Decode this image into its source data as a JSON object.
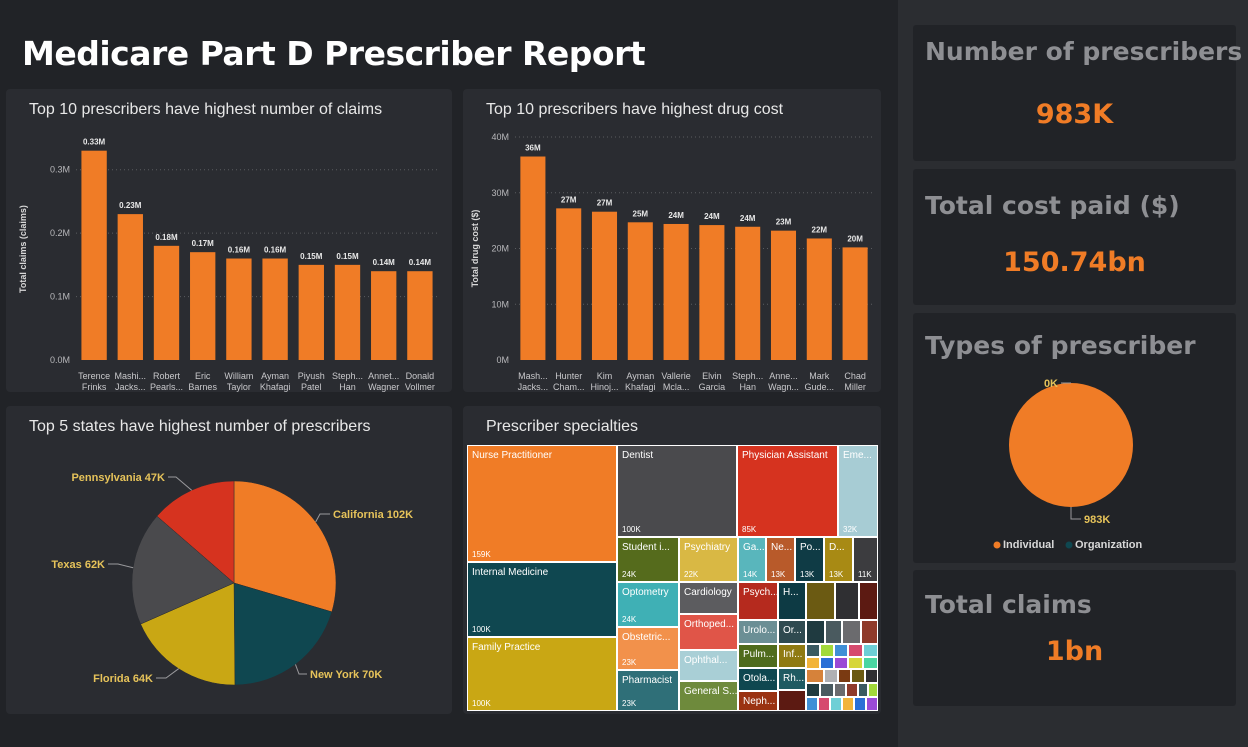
{
  "report": {
    "title": "Medicare Part D Prescriber Report"
  },
  "colors": {
    "accent": "#f07c26",
    "background": "#212327",
    "panel": "#2a2c31",
    "card_title": "#8e8f93"
  },
  "kpis": {
    "prescribers": {
      "title": "Number of prescribers",
      "value": "983K"
    },
    "cost": {
      "title": "Total cost paid ($)",
      "value": "150.74bn"
    },
    "types": {
      "title": "Types of prescriber"
    },
    "claims": {
      "title": "Total claims",
      "value": "1bn"
    }
  },
  "chart_data": [
    {
      "type": "bar",
      "title": "Top 10 prescribers have highest number of claims",
      "ylabel": "Total claims (claims)",
      "xlabel": "",
      "categories": [
        "Terence Frinks",
        "Mashi... Jacks...",
        "Robert Pearls...",
        "Eric Barnes",
        "William Taylor",
        "Ayman Khafagi",
        "Piyush Patel",
        "Steph... Han",
        "Annet... Wagner",
        "Donald Vollmer"
      ],
      "values": [
        0.33,
        0.23,
        0.18,
        0.17,
        0.16,
        0.16,
        0.15,
        0.15,
        0.14,
        0.14
      ],
      "data_labels": [
        "0.33M",
        "0.23M",
        "0.18M",
        "0.17M",
        "0.16M",
        "0.16M",
        "0.15M",
        "0.15M",
        "0.14M",
        "0.14M"
      ],
      "yticks": [
        0,
        0.1,
        0.2,
        0.3
      ],
      "ytick_labels": [
        "0.0M",
        "0.1M",
        "0.2M",
        "0.3M"
      ],
      "ylim": [
        0,
        0.35
      ],
      "color": "#f07c26",
      "grid": true
    },
    {
      "type": "bar",
      "title": "Top 10 prescribers have highest drug cost",
      "ylabel": "Total drug cost ($)",
      "xlabel": "",
      "categories": [
        "Mash... Jacks...",
        "Hunter Cham...",
        "Kim Hinoj...",
        "Ayman Khafagi",
        "Vallerie Mcla...",
        "Elvin Garcia",
        "Steph... Han",
        "Anne... Wagn...",
        "Mark Gude...",
        "Chad Miller"
      ],
      "values": [
        36.5,
        27.2,
        26.6,
        24.7,
        24.4,
        24.2,
        23.9,
        23.2,
        21.8,
        20.2
      ],
      "data_labels": [
        "36M",
        "27M",
        "27M",
        "25M",
        "24M",
        "24M",
        "24M",
        "23M",
        "22M",
        "20M"
      ],
      "yticks": [
        0,
        10,
        20,
        30,
        40
      ],
      "ytick_labels": [
        "0M",
        "10M",
        "20M",
        "30M",
        "40M"
      ],
      "ylim": [
        0,
        40
      ],
      "color": "#f07c26",
      "grid": true
    },
    {
      "type": "pie",
      "title": "Top 5 states have highest number of prescribers",
      "slices": [
        {
          "label": "California",
          "value": 102,
          "display": "California 102K",
          "color": "#f07c26"
        },
        {
          "label": "New York",
          "value": 70,
          "display": "New York 70K",
          "color": "#0f4750"
        },
        {
          "label": "Florida",
          "value": 64,
          "display": "Florida 64K",
          "color": "#c9a714"
        },
        {
          "label": "Texas",
          "value": 62,
          "display": "Texas 62K",
          "color": "#4a4a4d"
        },
        {
          "label": "Pennsylvania",
          "value": 47,
          "display": "Pennsylvania 47K",
          "color": "#d6331f"
        }
      ],
      "label_color": "#e6c35a"
    },
    {
      "type": "treemap",
      "title": "Prescriber specialties",
      "items": [
        {
          "label": "Nurse Practitioner",
          "value": "159K",
          "color": "#f07c26"
        },
        {
          "label": "Dentist",
          "value": "100K",
          "color": "#4a4a4d"
        },
        {
          "label": "Physician Assistant",
          "value": "85K",
          "color": "#d6331f"
        },
        {
          "label": "Eme...",
          "value": "32K",
          "color": "#a7ccd4"
        },
        {
          "label": "Internal Medicine",
          "value": "100K",
          "color": "#0f4750"
        },
        {
          "label": "Family Practice",
          "value": "100K",
          "color": "#c9a714"
        },
        {
          "label": "Student i...",
          "value": "24K",
          "color": "#556b1c"
        },
        {
          "label": "Psychiatry",
          "value": "22K",
          "color": "#d9b844"
        },
        {
          "label": "Ga...",
          "value": "14K",
          "color": "#59b6bc"
        },
        {
          "label": "Ne...",
          "value": "13K",
          "color": "#b85a2a"
        },
        {
          "label": "Po...",
          "value": "13K",
          "color": "#0f3b45"
        },
        {
          "label": "D...",
          "value": "13K",
          "color": "#a88a14"
        },
        {
          "label": "",
          "value": "11K",
          "color": "#3c3c3f"
        },
        {
          "label": "Optometry",
          "value": "24K",
          "color": "#3fb0b5"
        },
        {
          "label": "Cardiology",
          "value": "",
          "color": "#5c5c5f"
        },
        {
          "label": "Psych...",
          "value": "",
          "color": "#b52a1e"
        },
        {
          "label": "H...",
          "value": "",
          "color": "#0d3a44"
        },
        {
          "label": "Obstetric...",
          "value": "23K",
          "color": "#f2914b"
        },
        {
          "label": "Orthoped...",
          "value": "",
          "color": "#e05548"
        },
        {
          "label": "Urolo...",
          "value": "",
          "color": "#6b8f95"
        },
        {
          "label": "Or...",
          "value": "",
          "color": "#2f4a50"
        },
        {
          "label": "Ophthal...",
          "value": "",
          "color": "#a9cfd6"
        },
        {
          "label": "Pulm...",
          "value": "",
          "color": "#4f6b1c"
        },
        {
          "label": "Inf...",
          "value": "",
          "color": "#8f7a12"
        },
        {
          "label": "Pharmacist",
          "value": "23K",
          "color": "#2f6f78"
        },
        {
          "label": "General S...",
          "value": "",
          "color": "#6e8a3c"
        },
        {
          "label": "Otola...",
          "value": "",
          "color": "#0f4750"
        },
        {
          "label": "Rh...",
          "value": "",
          "color": "#1f5a62"
        },
        {
          "label": "Neph...",
          "value": "",
          "color": "#9a3212"
        }
      ]
    },
    {
      "type": "pie",
      "title": "Types of prescriber",
      "slices": [
        {
          "label": "Individual",
          "value": 983,
          "display": "983K",
          "color": "#f07c26"
        },
        {
          "label": "Organization",
          "value": 0,
          "display": "0K",
          "color": "#0f4750"
        }
      ],
      "legend": [
        "Individual",
        "Organization"
      ],
      "label_color": "#e6c35a"
    }
  ]
}
